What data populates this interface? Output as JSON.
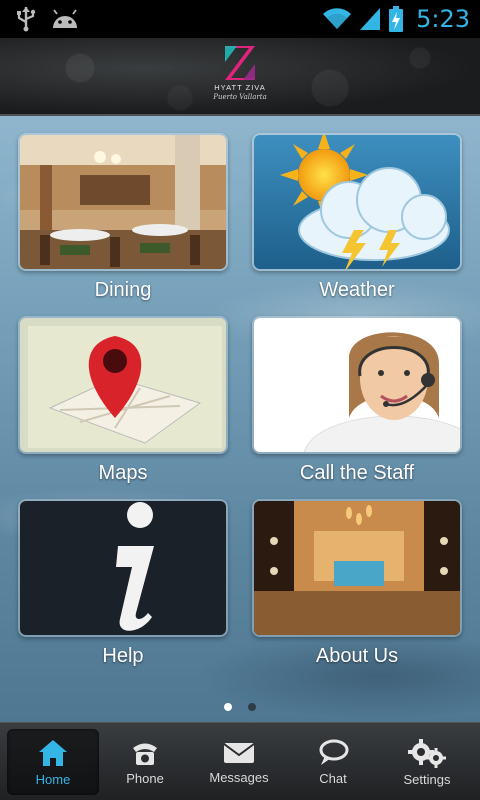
{
  "status_bar": {
    "time": "5:23",
    "icons": [
      "usb-icon",
      "android-debug-icon",
      "wifi-icon",
      "signal-icon",
      "battery-charging-icon"
    ]
  },
  "header": {
    "logo_name": "HYATT ZIVA",
    "logo_sub": "Puerto Vallarta"
  },
  "tiles": [
    {
      "label": "Dining",
      "image": "dining-room"
    },
    {
      "label": "Weather",
      "image": "weather-sun-cloud-lightning"
    },
    {
      "label": "Maps",
      "image": "map-pin"
    },
    {
      "label": "Call the Staff",
      "image": "support-agent-headset"
    },
    {
      "label": "Help",
      "image": "info-i"
    },
    {
      "label": "About Us",
      "image": "hotel-lobby"
    }
  ],
  "pager": {
    "total": 2,
    "current": 1
  },
  "tabbar": {
    "items": [
      {
        "label": "Home",
        "icon": "home-icon",
        "active": true
      },
      {
        "label": "Phone",
        "icon": "phone-icon",
        "active": false
      },
      {
        "label": "Messages",
        "icon": "envelope-icon",
        "active": false
      },
      {
        "label": "Chat",
        "icon": "chat-bubble-icon",
        "active": false
      },
      {
        "label": "Settings",
        "icon": "gears-icon",
        "active": false
      }
    ]
  },
  "colors": {
    "accent": "#33b5e5",
    "tabbar_bg": "#2b2d30",
    "sky": "#7fa8c1"
  }
}
